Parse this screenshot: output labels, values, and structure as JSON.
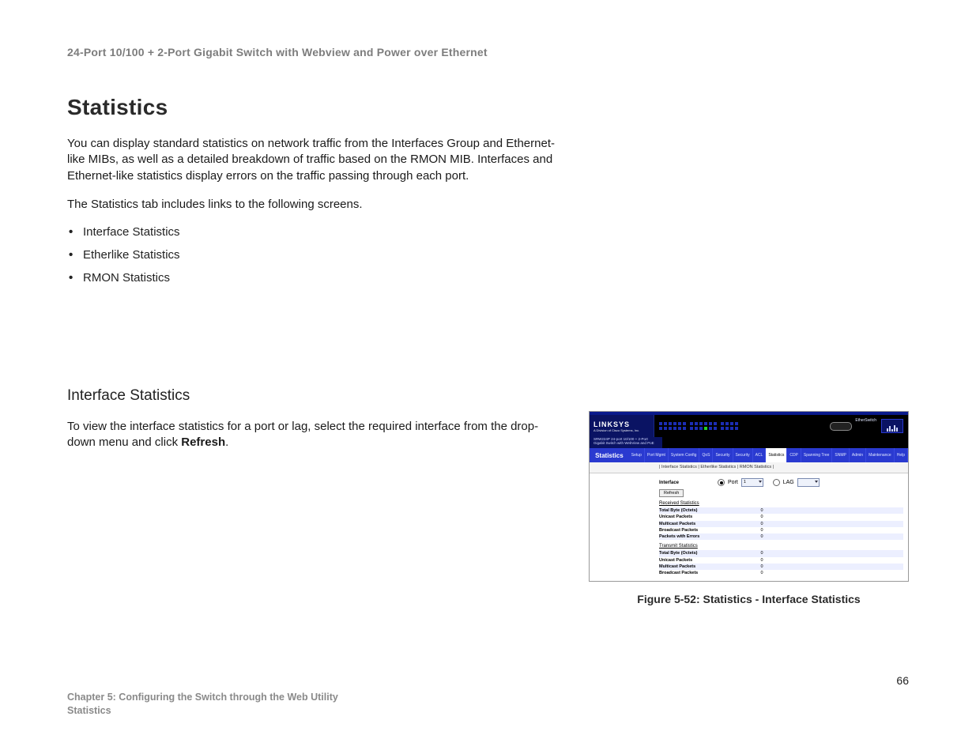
{
  "doc_header": "24-Port 10/100 + 2-Port Gigabit Switch with Webview and Power over Ethernet",
  "section_title": "Statistics",
  "intro_p1": "You can display standard statistics on network traffic from the Interfaces Group and Ethernet-like MIBs, as well as a detailed breakdown of traffic based on the RMON MIB. Interfaces and Ethernet-like statistics display errors on the traffic passing through each port.",
  "intro_p2": "The Statistics tab includes links to the following screens.",
  "bullets": [
    "Interface Statistics",
    "Etherlike Statistics",
    "RMON Statistics"
  ],
  "subsection_title": "Interface Statistics",
  "sub_p_prefix": "To view the interface statistics for a port or lag, select the required interface from the drop-down menu and click ",
  "sub_p_strong": "Refresh",
  "sub_p_suffix": ".",
  "figure": {
    "caption": "Figure 5-52: Statistics - Interface Statistics",
    "brand": "LINKSYS",
    "brand_sub": "A Division of Cisco Systems, Inc.",
    "device_desc": "SRW224P 24-port 10/100 + 2-Port Gigabit Switch with WebView and PoE",
    "device_label": "EtherSwitch",
    "nav_left": "Statistics",
    "tabs": [
      "Setup",
      "Port Mgmt",
      "System Config",
      "QoS",
      "Security",
      "Security",
      "ACL",
      "Statistics",
      "CDP",
      "Spanning Tree",
      "SNMP",
      "Admin",
      "Maintenance",
      "Help"
    ],
    "active_tab_index": 7,
    "subnav": "| Interface Statistics | Etherlike Statistics | RMON Statistics |",
    "form": {
      "label": "Interface",
      "port_radio": "Port",
      "port_value": "1",
      "lag_radio": "LAG",
      "lag_value": "",
      "refresh_btn": "Refresh"
    },
    "groups": [
      {
        "title": "Received Statistics",
        "rows": [
          {
            "k": "Total Byte (Octets)",
            "v": "0"
          },
          {
            "k": "Unicast Packets",
            "v": "0"
          },
          {
            "k": "Multicast Packets",
            "v": "0"
          },
          {
            "k": "Broadcast Packets",
            "v": "0"
          },
          {
            "k": "Packets with Errors",
            "v": "0"
          }
        ]
      },
      {
        "title": "Transmit Statistics",
        "rows": [
          {
            "k": "Total Byte (Octets)",
            "v": "0"
          },
          {
            "k": "Unicast Packets",
            "v": "0"
          },
          {
            "k": "Multicast Packets",
            "v": "0"
          },
          {
            "k": "Broadcast Packets",
            "v": "0"
          }
        ]
      }
    ]
  },
  "page_number": "66",
  "footer_line1": "Chapter 5: Configuring the Switch through the Web Utility",
  "footer_line2": "Statistics"
}
